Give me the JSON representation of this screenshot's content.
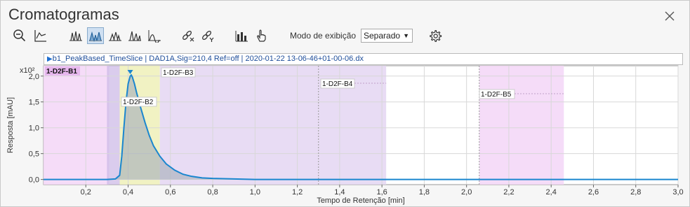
{
  "window": {
    "title": "Cromatogramas"
  },
  "toolbar": {
    "icons": [
      "zoom-out-icon",
      "baseline-icon",
      "peak-overlay-icon",
      "peak-separated-icon",
      "peak-stacked-icon",
      "peak-integrate-icon",
      "peak-area-icon",
      "unlink-x-icon",
      "unlink-y-icon",
      "chart-bars-icon",
      "hand-touch-icon",
      "gear-icon"
    ],
    "mode_label": "Modo de exibição",
    "mode_value": "Separado"
  },
  "trace_header": "b1_PeakBased_TimeSlice | DAD1A,Sig=210,4  Ref=off | 2020-01-22 13-06-46+01-00-06.dx",
  "chart_data": {
    "type": "line",
    "title": "",
    "xlabel": "Tempo de Retenção [min]",
    "ylabel": "Resposta [mAU]",
    "y_multiplier": "x10²",
    "xlim": [
      0,
      3.0
    ],
    "ylim": [
      -0.1,
      2.2
    ],
    "x_ticks": [
      "0,2",
      "0,4",
      "0,6",
      "0,8",
      "1,0",
      "1,2",
      "1,4",
      "1,6",
      "1,8",
      "2,0",
      "2,2",
      "2,4",
      "2,6",
      "2,8",
      "3,0"
    ],
    "y_ticks": [
      "0,0",
      "0,5",
      "1,0",
      "1,5",
      "2,0"
    ],
    "grid": true,
    "series": [
      {
        "color": "#1a86cf",
        "x": [
          0.0,
          0.3,
          0.34,
          0.36,
          0.37,
          0.38,
          0.39,
          0.4,
          0.41,
          0.415,
          0.42,
          0.43,
          0.44,
          0.46,
          0.48,
          0.5,
          0.52,
          0.55,
          0.58,
          0.62,
          0.66,
          0.7,
          0.75,
          0.8,
          0.9,
          1.0,
          1.2,
          1.6,
          2.0,
          2.5,
          3.0
        ],
        "y": [
          0.0,
          0.0,
          0.01,
          0.08,
          0.45,
          1.0,
          1.5,
          1.85,
          2.0,
          2.02,
          1.98,
          1.85,
          1.68,
          1.38,
          1.1,
          0.85,
          0.65,
          0.45,
          0.3,
          0.18,
          0.1,
          0.06,
          0.03,
          0.02,
          0.01,
          0.0,
          0.0,
          0.0,
          0.0,
          0.0,
          0.0
        ]
      }
    ],
    "segments": [
      {
        "label": "1-D2F-B1",
        "x0": 0.0,
        "x1": 0.31,
        "color": "#f3d6f7"
      },
      {
        "label": "1-D2F-B2",
        "x0": 0.36,
        "x1": 0.55,
        "color": "#eef0b8"
      },
      {
        "label": "1-D2F-B3",
        "x0": 0.55,
        "x1": 1.3,
        "color": "#e4d6f2"
      },
      {
        "label": "1-D2F-B4",
        "x0": 1.3,
        "x1": 1.62,
        "color": "#e4d6f2"
      },
      {
        "label": "1-D2F-B5",
        "x0": 2.06,
        "x1": 2.46,
        "color": "#f3d6f7"
      }
    ],
    "peak_marker_x": 0.41
  }
}
